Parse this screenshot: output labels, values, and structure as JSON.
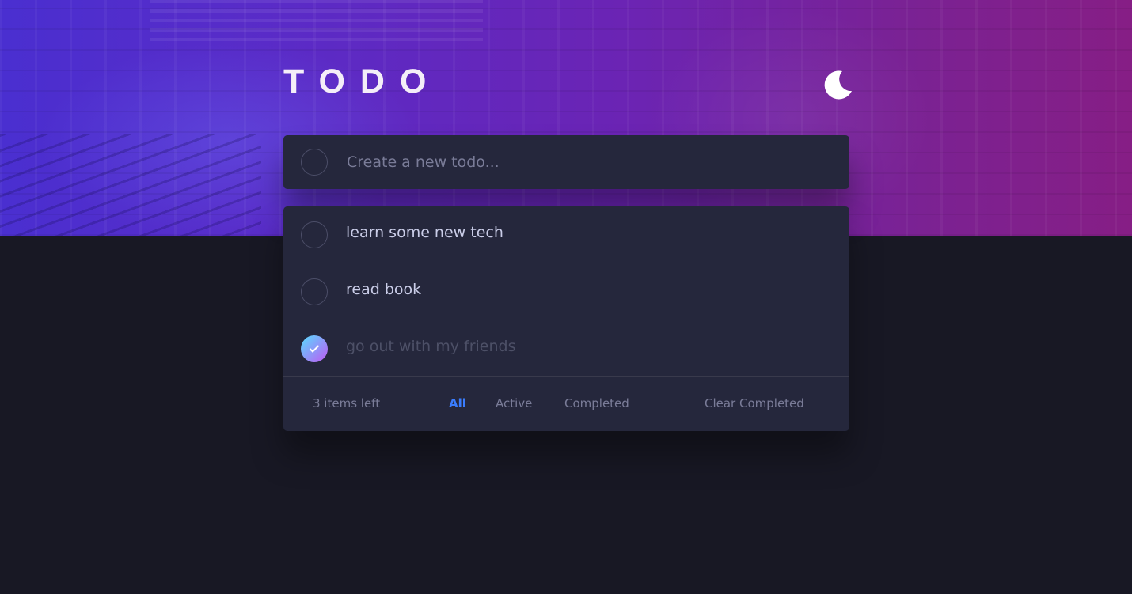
{
  "app": {
    "title": "TODO",
    "theme_icon": "moon-icon"
  },
  "new_todo": {
    "placeholder": "Create a new todo...",
    "value": ""
  },
  "todos": [
    {
      "text": "learn some new tech",
      "completed": false
    },
    {
      "text": "read book",
      "completed": false
    },
    {
      "text": "go out with my friends",
      "completed": true
    }
  ],
  "footer": {
    "items_left": "3 items left",
    "filters": {
      "all": "All",
      "active": "Active",
      "completed": "Completed"
    },
    "active_filter": "All",
    "clear_completed": "Clear Completed"
  },
  "colors": {
    "accent": "#3a7cfd",
    "card_bg": "#25273c",
    "page_bg": "#181824",
    "check_gradient_start": "#57ddff",
    "check_gradient_end": "#c058f3"
  }
}
